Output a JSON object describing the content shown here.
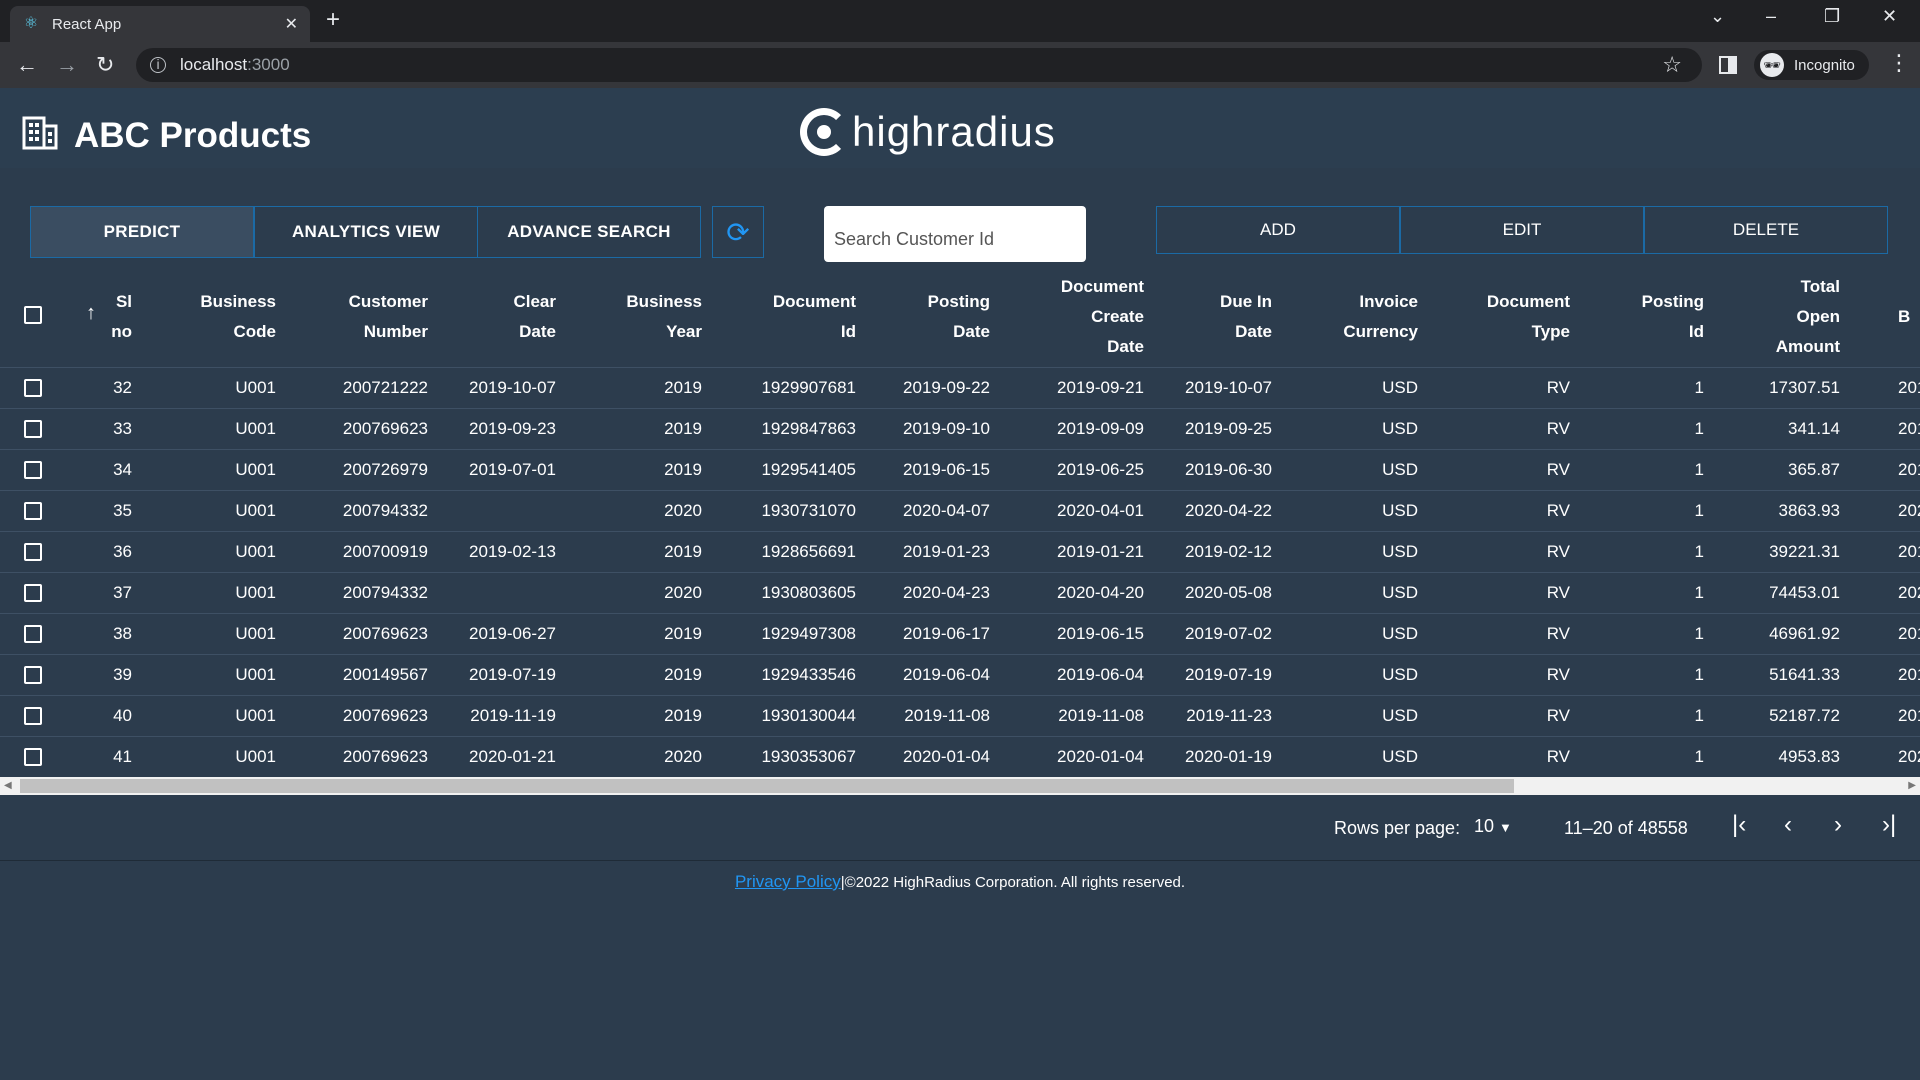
{
  "browser": {
    "tab_title": "React App",
    "url_host": "localhost",
    "url_port": ":3000",
    "profile_label": "Incognito"
  },
  "app": {
    "title": "ABC Products",
    "logo_text": "highradius"
  },
  "toolbar": {
    "predict": "PREDICT",
    "analytics": "ANALYTICS VIEW",
    "advance_search": "ADVANCE SEARCH",
    "search_placeholder": "Search Customer Id",
    "add": "ADD",
    "edit": "EDIT",
    "delete": "DELETE"
  },
  "table": {
    "headers": [
      [
        "Sl",
        "no"
      ],
      [
        "Business",
        "Code"
      ],
      [
        "Customer",
        "Number"
      ],
      [
        "Clear",
        "Date"
      ],
      [
        "Business",
        "Year"
      ],
      [
        "Document",
        "Id"
      ],
      [
        "Posting",
        "Date"
      ],
      [
        "Document",
        "Create",
        "Date"
      ],
      [
        "Due In",
        "Date"
      ],
      [
        "Invoice",
        "Currency"
      ],
      [
        "Document",
        "Type"
      ],
      [
        "Posting",
        "Id"
      ],
      [
        "Total",
        "Open",
        "Amount"
      ],
      [
        "B"
      ]
    ],
    "rows": [
      [
        "32",
        "U001",
        "200721222",
        "2019-10-07",
        "2019",
        "1929907681",
        "2019-09-22",
        "2019-09-21",
        "2019-10-07",
        "USD",
        "RV",
        "1",
        "17307.51",
        "201"
      ],
      [
        "33",
        "U001",
        "200769623",
        "2019-09-23",
        "2019",
        "1929847863",
        "2019-09-10",
        "2019-09-09",
        "2019-09-25",
        "USD",
        "RV",
        "1",
        "341.14",
        "201"
      ],
      [
        "34",
        "U001",
        "200726979",
        "2019-07-01",
        "2019",
        "1929541405",
        "2019-06-15",
        "2019-06-25",
        "2019-06-30",
        "USD",
        "RV",
        "1",
        "365.87",
        "201"
      ],
      [
        "35",
        "U001",
        "200794332",
        "",
        "2020",
        "1930731070",
        "2020-04-07",
        "2020-04-01",
        "2020-04-22",
        "USD",
        "RV",
        "1",
        "3863.93",
        "202"
      ],
      [
        "36",
        "U001",
        "200700919",
        "2019-02-13",
        "2019",
        "1928656691",
        "2019-01-23",
        "2019-01-21",
        "2019-02-12",
        "USD",
        "RV",
        "1",
        "39221.31",
        "201"
      ],
      [
        "37",
        "U001",
        "200794332",
        "",
        "2020",
        "1930803605",
        "2020-04-23",
        "2020-04-20",
        "2020-05-08",
        "USD",
        "RV",
        "1",
        "74453.01",
        "202"
      ],
      [
        "38",
        "U001",
        "200769623",
        "2019-06-27",
        "2019",
        "1929497308",
        "2019-06-17",
        "2019-06-15",
        "2019-07-02",
        "USD",
        "RV",
        "1",
        "46961.92",
        "201"
      ],
      [
        "39",
        "U001",
        "200149567",
        "2019-07-19",
        "2019",
        "1929433546",
        "2019-06-04",
        "2019-06-04",
        "2019-07-19",
        "USD",
        "RV",
        "1",
        "51641.33",
        "201"
      ],
      [
        "40",
        "U001",
        "200769623",
        "2019-11-19",
        "2019",
        "1930130044",
        "2019-11-08",
        "2019-11-08",
        "2019-11-23",
        "USD",
        "RV",
        "1",
        "52187.72",
        "201"
      ],
      [
        "41",
        "U001",
        "200769623",
        "2020-01-21",
        "2020",
        "1930353067",
        "2020-01-04",
        "2020-01-04",
        "2020-01-19",
        "USD",
        "RV",
        "1",
        "4953.83",
        "202"
      ]
    ]
  },
  "pagination": {
    "rows_label": "Rows per page:",
    "rows_value": "10",
    "range": "11–20 of 48558"
  },
  "footer": {
    "link": "Privacy Policy",
    "text": "|©2022 HighRadius Corporation. All rights reserved."
  },
  "colors": {
    "background": "#2c3c4d",
    "accent": "#2196f3",
    "border": "#1b6aa5"
  }
}
